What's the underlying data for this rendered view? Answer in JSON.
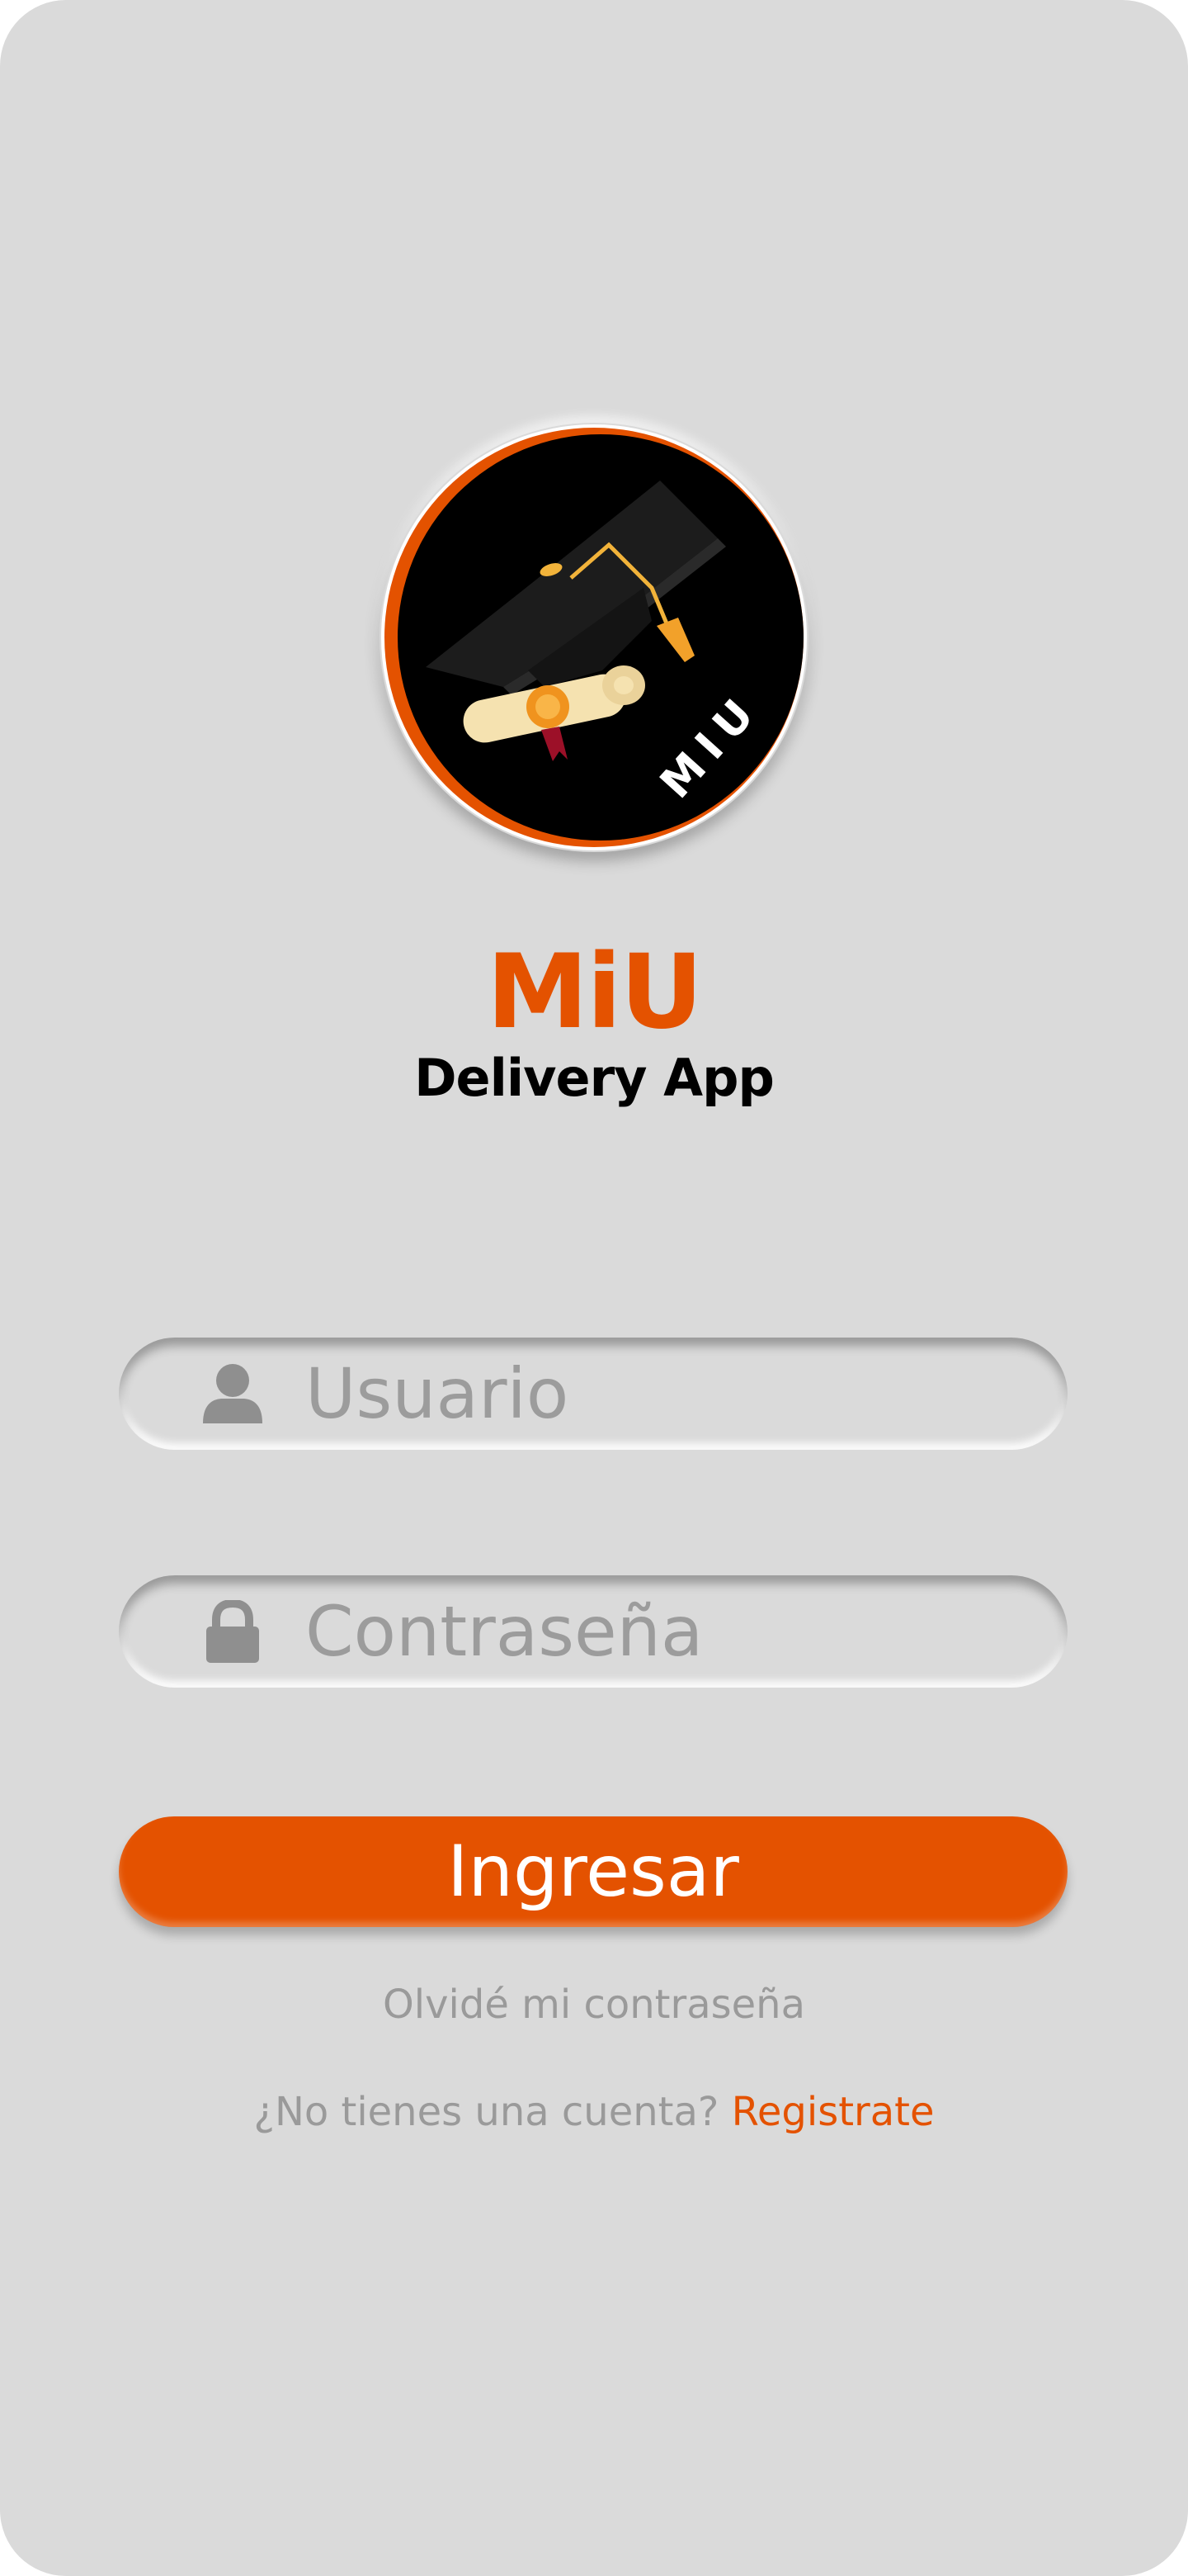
{
  "app": {
    "name": "MiU",
    "subtitle": "Delivery App",
    "logo_text": "MIU"
  },
  "login": {
    "username_placeholder": "Usuario",
    "password_placeholder": "Contraseña",
    "submit_label": "Ingresar",
    "forgot_label": "Olvidé mi contraseña",
    "no_account_text": "¿No tienes una cuenta?",
    "register_label": "Registrate"
  },
  "icons": {
    "user": "user-icon",
    "lock": "lock-icon",
    "logo": "graduation-cap-diploma-logo"
  },
  "colors": {
    "accent": "#e45200",
    "background": "#dadada",
    "placeholder": "#9c9c9c",
    "muted_text": "#9a9a9a",
    "title_dark": "#000000"
  }
}
